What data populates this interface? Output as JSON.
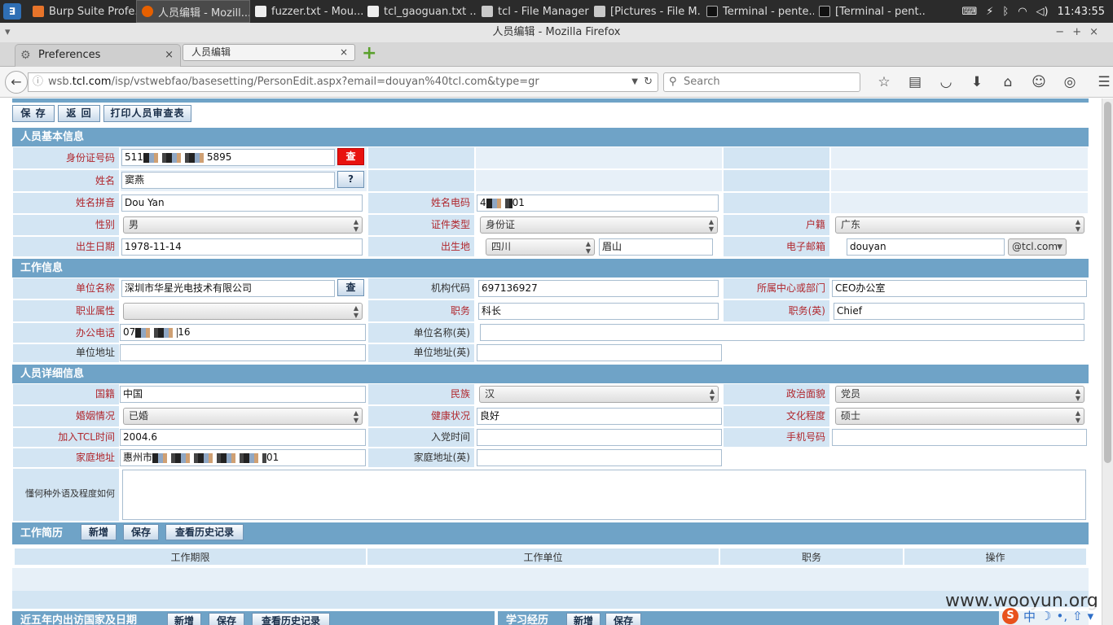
{
  "taskbar": {
    "tasks": [
      {
        "label": "Burp Suite Profe...",
        "icon": "burp-icon"
      },
      {
        "label": "人员编辑 - Mozill...",
        "icon": "firefox-icon"
      },
      {
        "label": "fuzzer.txt - Mou...",
        "icon": "editor-icon"
      },
      {
        "label": "tcl_gaoguan.txt ...",
        "icon": "editor-icon"
      },
      {
        "label": "tcl - File Manager",
        "icon": "folder-icon"
      },
      {
        "label": "[Pictures - File M...",
        "icon": "folder-icon"
      },
      {
        "label": "Terminal - pente...",
        "icon": "terminal-icon"
      },
      {
        "label": "[Terminal - pent...",
        "icon": "terminal-icon"
      }
    ],
    "clock": "11:43:55"
  },
  "window": {
    "title": "人员编辑 - Mozilla Firefox"
  },
  "tabs": [
    {
      "label": "Preferences"
    },
    {
      "label": "人员编辑"
    }
  ],
  "nav": {
    "url_pre": "wsb.",
    "url_domain": "tcl.com",
    "url_post": "/isp/vstwebfao/basesetting/PersonEdit.aspx?email=douyan%40tcl.com&type=gr",
    "search_placeholder": "Search"
  },
  "toolbar": {
    "save": "保 存",
    "back": "返 回",
    "print": "打印人员审查表"
  },
  "sections": {
    "basic": "人员基本信息",
    "work": "工作信息",
    "detail": "人员详细信息",
    "resume": "工作简历",
    "abroad": "近五年内出访国家及日期",
    "study": "学习经历"
  },
  "basic": {
    "id_label": "身份证号码",
    "id_pre": "511",
    "id_post": "5895",
    "id_btn": "查",
    "name_label": "姓名",
    "name": "窦燕",
    "name_btn": "?",
    "pinyin_label": "姓名拼音",
    "pinyin": "Dou Yan",
    "code_label": "姓名电码",
    "code_pre": "4",
    "code_post": "01",
    "gender_label": "性别",
    "gender": "男",
    "idtype_label": "证件类型",
    "idtype": "身份证",
    "huji_label": "户籍",
    "huji": "广东",
    "birth_label": "出生日期",
    "birth": "1978-11-14",
    "birthplace_label": "出生地",
    "birth_prov": "四川",
    "birth_city": "眉山",
    "email_label": "电子邮箱",
    "email": "douyan",
    "email_domain": "@tcl.com"
  },
  "work": {
    "company_label": "单位名称",
    "company": "深圳市华星光电技术有限公司",
    "company_btn": "查",
    "orgcode_label": "机构代码",
    "orgcode": "697136927",
    "dept_label": "所属中心或部门",
    "dept": "CEO办公室",
    "attr_label": "职业属性",
    "attr": "",
    "post_label": "职务",
    "post": "科长",
    "post_en_label": "职务(英)",
    "post_en": "Chief",
    "tel_label": "办公电话",
    "tel_pre": "07",
    "tel_post": "16",
    "company_en_label": "单位名称(英)",
    "company_en": "",
    "addr_label": "单位地址",
    "addr": "",
    "addr_en_label": "单位地址(英)",
    "addr_en": ""
  },
  "detail": {
    "nation_label": "国籍",
    "nation": "中国",
    "ethnic_label": "民族",
    "ethnic": "汉",
    "political_label": "政治面貌",
    "political": "党员",
    "marital_label": "婚姻情况",
    "marital": "已婚",
    "health_label": "健康状况",
    "health": "良好",
    "edu_label": "文化程度",
    "edu": "硕士",
    "join_label": "加入TCL时间",
    "join": "2004.6",
    "party_label": "入党时间",
    "party": "",
    "mobile_label": "手机号码",
    "mobile": "",
    "home_label": "家庭地址",
    "home_pre": "惠州市",
    "home_post": "01",
    "home_en_label": "家庭地址(英)",
    "home_en": "",
    "lang_label": "懂何种外语及程度如何",
    "lang": ""
  },
  "resume": {
    "btn_add": "新增",
    "btn_save": "保存",
    "btn_history": "查看历史记录",
    "columns": [
      "工作期限",
      "工作单位",
      "职务",
      "操作"
    ]
  },
  "abroad": {
    "btn_add": "新增",
    "btn_save": "保存",
    "btn_history": "查看历史记录"
  },
  "study": {
    "btn_add": "新增",
    "btn_save": "保存"
  },
  "watermark": "www.wooyun.org",
  "ime": {
    "lang": "中"
  }
}
